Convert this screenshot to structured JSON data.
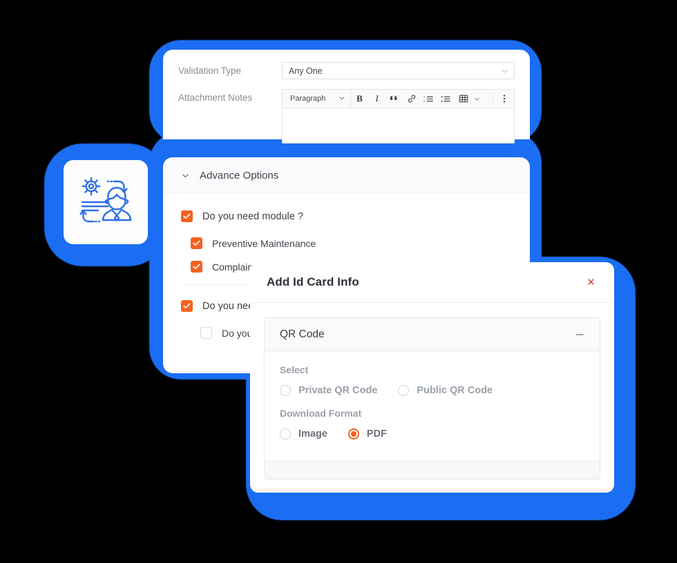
{
  "theme": {
    "accent_orange": "#F4621F",
    "glow_blue": "#1B6EF3",
    "close_red": "#D6342A",
    "icon_blue": "#2C6FE8",
    "label_gray": "#878D96",
    "text_dark": "#3C4148"
  },
  "top_card": {
    "rows": [
      {
        "label": "Validation Type",
        "type": "select",
        "value": "Any One"
      },
      {
        "label": "Attachment Notes",
        "type": "editor"
      }
    ],
    "editor": {
      "block_format": "Paragraph",
      "tools": [
        {
          "name": "bold-icon",
          "glyph": "B"
        },
        {
          "name": "italic-icon",
          "glyph": "I"
        },
        {
          "name": "blockquote-icon",
          "glyph": "“"
        },
        {
          "name": "link-icon",
          "glyph": "🔗"
        },
        {
          "name": "ordered-list-icon",
          "glyph": "1."
        },
        {
          "name": "bullet-list-icon",
          "glyph": "•"
        },
        {
          "name": "table-icon",
          "glyph": "⊞"
        },
        {
          "name": "more-options-icon",
          "glyph": "⋮"
        }
      ],
      "content": ""
    }
  },
  "advance_card": {
    "header": {
      "title": "Advance Options",
      "caret": "chevron-down-icon"
    },
    "checkboxes": [
      {
        "label": "Do you need module ?",
        "checked": true,
        "indent": 0
      },
      {
        "label": "Preventive Maintenance",
        "checked": true,
        "indent": 1
      },
      {
        "label": "Complaint Management",
        "checked": true,
        "indent": 1
      },
      {
        "label": "Do you need id card ?",
        "checked": true,
        "indent": 0
      },
      {
        "label": "Do you need qr code ?",
        "checked": false,
        "indent": 2
      }
    ]
  },
  "badge": {
    "icon_name": "employee-process-management-icon",
    "alt": "Gear, process arrows and person illustration"
  },
  "modal": {
    "title": "Add Id Card Info",
    "close_label": "×",
    "panel": {
      "title": "QR Code",
      "collapse_glyph": "−",
      "groups": [
        {
          "label": "Select",
          "name": "qr-type",
          "options": [
            {
              "label": "Private QR Code",
              "selected": false
            },
            {
              "label": "Public QR Code",
              "selected": false
            }
          ]
        },
        {
          "label": "Download Format",
          "name": "download-format",
          "options": [
            {
              "label": "Image",
              "selected": false
            },
            {
              "label": "PDF",
              "selected": true
            }
          ]
        }
      ]
    }
  }
}
